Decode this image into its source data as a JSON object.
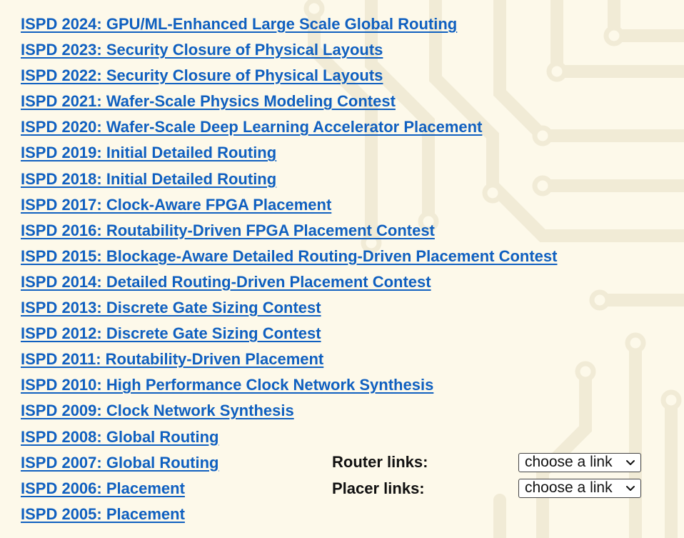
{
  "contests": [
    {
      "label": "ISPD 2024: GPU/ML-Enhanced Large Scale Global Routing"
    },
    {
      "label": "ISPD 2023: Security Closure of Physical Layouts"
    },
    {
      "label": "ISPD 2022: Security Closure of Physical Layouts"
    },
    {
      "label": "ISPD 2021: Wafer-Scale Physics Modeling Contest"
    },
    {
      "label": "ISPD 2020: Wafer-Scale Deep Learning Accelerator Placement"
    },
    {
      "label": "ISPD 2019: Initial Detailed Routing"
    },
    {
      "label": "ISPD 2018: Initial Detailed Routing"
    },
    {
      "label": "ISPD 2017: Clock-Aware FPGA Placement"
    },
    {
      "label": "ISPD 2016: Routability-Driven FPGA Placement Contest"
    },
    {
      "label": "ISPD 2015: Blockage-Aware Detailed Routing-Driven Placement Contest"
    },
    {
      "label": "ISPD 2014: Detailed Routing-Driven Placement Contest"
    },
    {
      "label": "ISPD 2013: Discrete Gate Sizing Contest"
    },
    {
      "label": "ISPD 2012: Discrete Gate Sizing Contest"
    },
    {
      "label": "ISPD 2011: Routability-Driven Placement"
    },
    {
      "label": "ISPD 2010: High Performance Clock Network Synthesis"
    },
    {
      "label": "ISPD 2009: Clock Network Synthesis"
    },
    {
      "label": "ISPD 2008: Global Routing"
    },
    {
      "label": "ISPD 2007: Global Routing"
    },
    {
      "label": "ISPD 2006: Placement"
    },
    {
      "label": "ISPD 2005: Placement"
    }
  ],
  "router_links": {
    "label": "Router links:",
    "selected": "choose a link"
  },
  "placer_links": {
    "label": "Placer links:",
    "selected": "choose a link"
  },
  "colors": {
    "background": "#fdf9ea",
    "link": "#1060c0",
    "circuit_trace": "#f1ebd6"
  },
  "icons": {
    "dropdown": "chevron-down-icon"
  }
}
